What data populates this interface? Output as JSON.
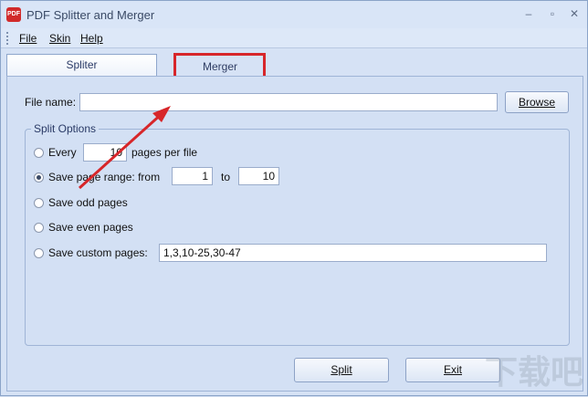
{
  "window": {
    "title": "PDF Splitter and Merger",
    "icon_label": "PDF"
  },
  "menu": {
    "file": "File",
    "skin": "Skin",
    "help": "Help"
  },
  "tabs": {
    "splitter": "Spliter",
    "merger": "Merger"
  },
  "file": {
    "label": "File name:",
    "value": "",
    "browse": "Browse"
  },
  "split_options": {
    "legend": "Split Options",
    "every_label": "Every",
    "every_value": "10",
    "pages_per_file": "pages per file",
    "range_label": "Save page range: from",
    "range_from": "1",
    "range_to_label": "to",
    "range_to": "10",
    "odd_label": "Save odd pages",
    "even_label": "Save even pages",
    "custom_label": "Save custom pages:",
    "custom_value": "1,3,10-25,30-47",
    "selected": "range"
  },
  "actions": {
    "split": "Split",
    "exit": "Exit"
  },
  "colors": {
    "highlight": "#d7262a",
    "accent": "#2a3a66"
  },
  "watermark": "下载吧"
}
